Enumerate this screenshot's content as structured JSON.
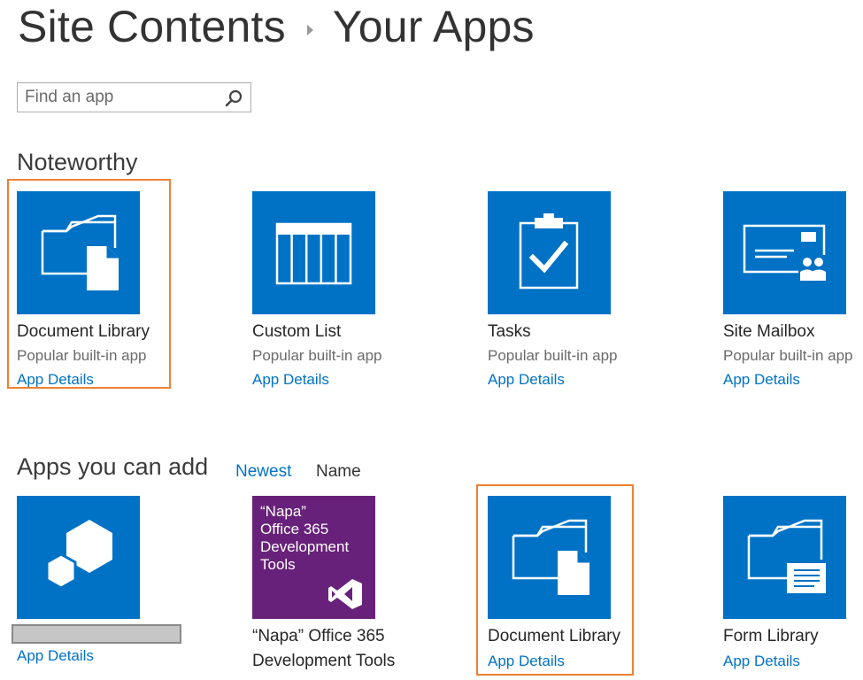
{
  "breadcrumb": {
    "root": "Site Contents",
    "current": "Your Apps"
  },
  "search": {
    "placeholder": "Find an app"
  },
  "noteworthy": {
    "title": "Noteworthy",
    "tiles": [
      {
        "name": "Document Library",
        "subtitle": "Popular built-in app",
        "link": "App Details",
        "icon": "document-library-icon"
      },
      {
        "name": "Custom List",
        "subtitle": "Popular built-in app",
        "link": "App Details",
        "icon": "custom-list-icon"
      },
      {
        "name": "Tasks",
        "subtitle": "Popular built-in app",
        "link": "App Details",
        "icon": "tasks-icon"
      },
      {
        "name": "Site Mailbox",
        "subtitle": "Popular built-in app",
        "link": "App Details",
        "icon": "site-mailbox-icon"
      }
    ]
  },
  "apps_you_can_add": {
    "title": "Apps you can add",
    "sort_options": [
      "Newest",
      "Name"
    ],
    "tiles": [
      {
        "name": "",
        "link": "App Details",
        "icon": "app-cube-icon"
      },
      {
        "name": "“Napa” Office 365 Development Tools",
        "tile_text": "“Napa”\nOffice 365\nDevelopment\nTools",
        "icon": "visual-studio-icon"
      },
      {
        "name": "Document Library",
        "link": "App Details",
        "icon": "document-library-icon"
      },
      {
        "name": "Form Library",
        "link": "App Details",
        "icon": "form-library-icon"
      }
    ]
  },
  "colors": {
    "tile_blue": "#0072c6",
    "tile_purple": "#68217a",
    "link_blue": "#0072c6",
    "highlight_orange": "#ef8033"
  }
}
